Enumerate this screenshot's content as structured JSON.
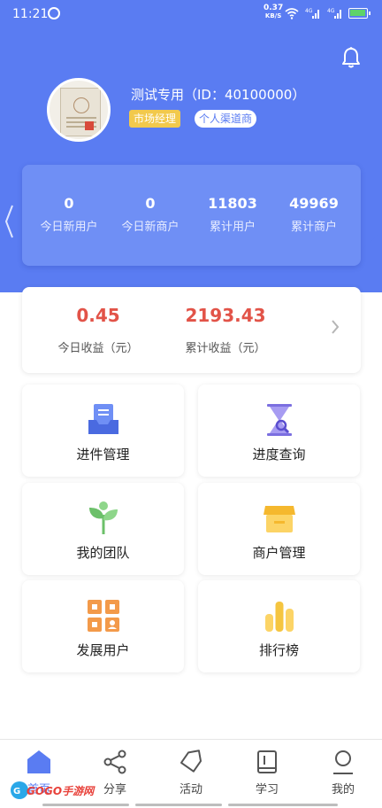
{
  "status_bar": {
    "time": "11:21",
    "net_speed_value": "0.37",
    "net_speed_unit": "KB/S",
    "signal_label_1": "4G",
    "signal_label_2": "4G",
    "battery_level": 0.8,
    "battery_color": "#5ed36a"
  },
  "profile": {
    "name": "测试专用（ID：40100000）",
    "tags": [
      "市场经理",
      "个人渠道商"
    ]
  },
  "stats": [
    {
      "value": "0",
      "label": "今日新用户"
    },
    {
      "value": "0",
      "label": "今日新商户"
    },
    {
      "value": "11803",
      "label": "累计用户"
    },
    {
      "value": "49969",
      "label": "累计商户"
    }
  ],
  "earnings": [
    {
      "value": "0.45",
      "label": "今日收益（元）"
    },
    {
      "value": "2193.43",
      "label": "累计收益（元）"
    }
  ],
  "tiles": [
    {
      "label": "进件管理",
      "icon": "inbox-doc-icon"
    },
    {
      "label": "进度查询",
      "icon": "hourglass-search-icon"
    },
    {
      "label": "我的团队",
      "icon": "sprout-icon"
    },
    {
      "label": "商户管理",
      "icon": "store-icon"
    },
    {
      "label": "发展用户",
      "icon": "qr-grid-icon"
    },
    {
      "label": "排行榜",
      "icon": "bar-ranking-icon"
    }
  ],
  "tabbar": [
    {
      "label": "首页",
      "icon": "home-icon",
      "active": true
    },
    {
      "label": "分享",
      "icon": "share-icon",
      "active": false
    },
    {
      "label": "活动",
      "icon": "tag-icon",
      "active": false
    },
    {
      "label": "学习",
      "icon": "book-icon",
      "active": false
    },
    {
      "label": "我的",
      "icon": "user-icon",
      "active": false
    }
  ],
  "watermark": "GOGO手游网",
  "colors": {
    "primary": "#5a7cf2",
    "earnings_red": "#e25348",
    "tag_yellow": "#f2c94c"
  }
}
